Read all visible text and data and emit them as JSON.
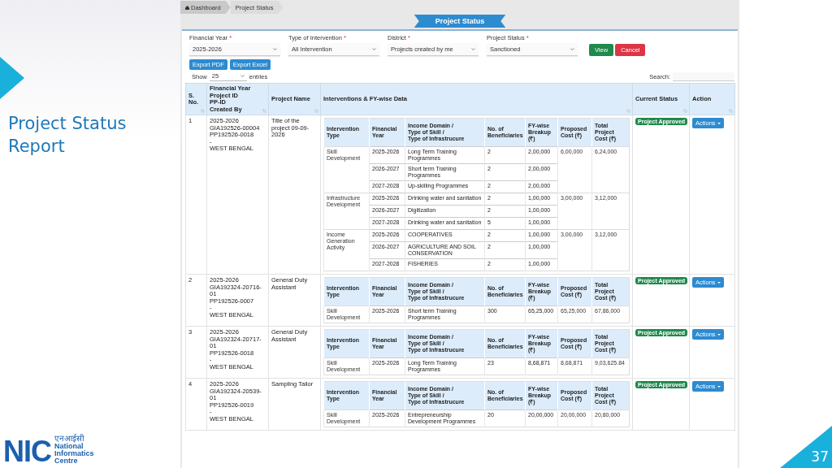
{
  "slide": {
    "title": "Project Status Report",
    "page_number": "37",
    "logo": {
      "mark": "NIC",
      "hindi": "एनआईसी",
      "lines": [
        "National",
        "Informatics",
        "Centre"
      ]
    }
  },
  "breadcrumb": [
    {
      "label": "Dashboard",
      "selected": false
    },
    {
      "label": "Project Status",
      "selected": true
    }
  ],
  "banner": "Project Status",
  "filters": [
    {
      "label": "Financial Year",
      "marker": "*",
      "value": "2025-2026"
    },
    {
      "label": "Type of Intervention",
      "marker": "*",
      "value": "All Intervention"
    },
    {
      "label": "District",
      "marker": "*",
      "value": "Projects created by me"
    },
    {
      "label": "Project Status",
      "marker": "*",
      "value": "Sanctioned"
    }
  ],
  "buttons": [
    {
      "label": "View",
      "kind": "success"
    },
    {
      "label": "Cancel",
      "kind": "danger"
    }
  ],
  "exports": [
    "Export PDF",
    "Export Excel"
  ],
  "length": {
    "prefix": "Show",
    "value": "25",
    "suffix": "entries"
  },
  "search": {
    "label": "Search:"
  },
  "table": {
    "columns": [
      "S. No.",
      "Financial Year\nProject ID\nPP-ID\nCreated By",
      "Project Name",
      "Interventions & FY-wise Data",
      "Current Status",
      "Action"
    ],
    "rows": [
      {
        "sno": "1",
        "info": "2025-2026\nGIA192526-00004\nPP192526-0018\n-\nWEST BENGAL",
        "name": "Title of the project 09-09-2026",
        "status": "Project Approved",
        "action": "Actions",
        "columns": [
          "Intervention Type",
          "Financial Year",
          "Income Domain /\nType of Skill /\nType of Infrastrucure",
          "No. of Beneficiaries",
          "FY-wise Breakup (₹)",
          "Proposed Cost (₹)",
          "Total Project Cost (₹)"
        ],
        "interventions": [
          {
            "type": "Skill Development",
            "proposed": "6,00,000",
            "total": "6,24,000",
            "years": [
              {
                "fy": "2025-2026",
                "domain": "Long Term Training Programmes",
                "beneficiaries": "2",
                "breakup": "2,00,000"
              },
              {
                "fy": "2026-2027",
                "domain": "Short term Training Programmes",
                "beneficiaries": "2",
                "breakup": "2,00,000"
              },
              {
                "fy": "2027-2028",
                "domain": "Up-skilling Programmes",
                "beneficiaries": "2",
                "breakup": "2,00,000"
              }
            ]
          },
          {
            "type": "Infrastructure Development",
            "proposed": "3,00,000",
            "total": "3,12,000",
            "years": [
              {
                "fy": "2025-2026",
                "domain": "Drinking water and sanitation",
                "beneficiaries": "2",
                "breakup": "1,00,000"
              },
              {
                "fy": "2026-2027",
                "domain": "Digitization",
                "beneficiaries": "2",
                "breakup": "1,00,000"
              },
              {
                "fy": "2027-2028",
                "domain": "Drinking water and sanitation",
                "beneficiaries": "5",
                "breakup": "1,00,000"
              }
            ]
          },
          {
            "type": "Income Generation Activity",
            "proposed": "3,00,000",
            "total": "3,12,000",
            "years": [
              {
                "fy": "2025-2026",
                "domain": "COOPERATIVES",
                "beneficiaries": "2",
                "breakup": "1,00,000"
              },
              {
                "fy": "2026-2027",
                "domain": "AGRICULTURE AND SOIL CONSERVATION",
                "beneficiaries": "2",
                "breakup": "1,00,000"
              },
              {
                "fy": "2027-2028",
                "domain": "FISHERIES",
                "beneficiaries": "2",
                "breakup": "1,00,000"
              }
            ]
          }
        ]
      },
      {
        "sno": "2",
        "info": "2025-2026\nGIA192324-20716-01\nPP192526-0007\n-\nWEST BENGAL",
        "name": "General Duty Assistant",
        "status": "Project Approved",
        "action": "Actions",
        "columns": [
          "Intervention Type",
          "Financial Year",
          "Income Domain /\nType of Skill /\nType of Infrastrucure",
          "No. of Beneficiaries",
          "FY-wise Breakup (₹)",
          "Proposed Cost (₹)",
          "Total Project Cost (₹)"
        ],
        "interventions": [
          {
            "type": "Skill Development",
            "proposed": "65,25,000",
            "total": "67,86,000",
            "years": [
              {
                "fy": "2025-2026",
                "domain": "Short term Training Programmes",
                "beneficiaries": "300",
                "breakup": "65,25,000"
              }
            ]
          }
        ]
      },
      {
        "sno": "3",
        "info": "2025-2026\nGIA192324-20717-01\nPP192526-0018\n-\nWEST BENGAL",
        "name": "General Duty Assistant",
        "status": "Project Approved",
        "action": "Actions",
        "columns": [
          "Intervention Type",
          "Financial Year",
          "Income Domain /\nType of Skill /\nType of Infrastrucure",
          "No. of Beneficiaries",
          "FY-wise Breakup (₹)",
          "Proposed Cost (₹)",
          "Total Project Cost (₹)"
        ],
        "interventions": [
          {
            "type": "Skill Development",
            "proposed": "8,68,871",
            "total": "9,03,625.84",
            "years": [
              {
                "fy": "2025-2026",
                "domain": "Long Term Training Programmes",
                "beneficiaries": "23",
                "breakup": "8,68,871"
              }
            ]
          }
        ]
      },
      {
        "sno": "4",
        "info": "2025-2026\nGIA192324-20539-01\nPP192526-0019\n-\nWEST BENGAL",
        "name": "Sampling Tailor",
        "status": "Project Approved",
        "action": "Actions",
        "columns": [
          "Intervention Type",
          "Financial Year",
          "Income Domain /\nType of Skill /\nType of Infrastrucure",
          "No. of Beneficiaries",
          "FY-wise Breakup (₹)",
          "Proposed Cost (₹)",
          "Total Project Cost (₹)"
        ],
        "interventions": [
          {
            "type": "Skill Development",
            "proposed": "20,00,000",
            "total": "20,80,000",
            "years": [
              {
                "fy": "2025-2026",
                "domain": "Entrepreneurship Development Programmes",
                "beneficiaries": "20",
                "breakup": "20,00,000"
              }
            ]
          }
        ]
      }
    ]
  }
}
